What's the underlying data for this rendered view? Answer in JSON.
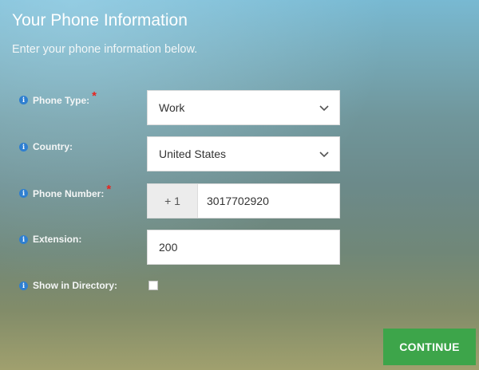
{
  "header": {
    "title": "Your Phone Information",
    "subtitle": "Enter your phone information below."
  },
  "form": {
    "phone_type": {
      "label": "Phone Type:",
      "required": "*",
      "value": "Work"
    },
    "country": {
      "label": "Country:",
      "value": "United States"
    },
    "phone_number": {
      "label": "Phone Number:",
      "required": "*",
      "prefix": "+ 1",
      "value": "3017702920"
    },
    "extension": {
      "label": "Extension:",
      "value": "200"
    },
    "show_in_directory": {
      "label": "Show in Directory:",
      "checked": false
    }
  },
  "actions": {
    "continue_label": "CONTINUE"
  },
  "icons": {
    "info": "info-icon",
    "dropdown": "chevron-down-icon"
  },
  "colors": {
    "required": "#e8231f",
    "continue_button": "#3da54a",
    "info_icon": "#2f7fd0"
  }
}
